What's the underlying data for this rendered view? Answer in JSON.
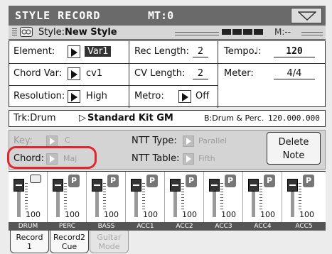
{
  "title_bar": {
    "title": "STYLE RECORD",
    "mt": "MT:0"
  },
  "style_row": {
    "prefix": "Style:",
    "name": "New Style",
    "measure": "M:--"
  },
  "params": {
    "element_label": "Element:",
    "element_value": "Var1",
    "chordvar_label": "Chord Var:",
    "chordvar_value": "cv1",
    "resolution_label": "Resolution:",
    "resolution_value": "High",
    "reclength_label": "Rec Length:",
    "reclength_value": "2",
    "cvlength_label": "CV Length:",
    "cvlength_value": "2",
    "metro_label": "Metro:",
    "metro_value": "Off",
    "tempo_label": "Tempo",
    "tempo_note": "♩:",
    "tempo_value": "120",
    "meter_label": "Meter:",
    "meter_value": "4/4"
  },
  "track_row": {
    "trk": "Trk:Drum",
    "kit": "Standard Kit GM",
    "bank": "B:Drum & Perc.",
    "number": "120.000.000"
  },
  "panel": {
    "key_label": "Key:",
    "key_value": "C",
    "chord_label": "Chord:",
    "chord_value": "Maj",
    "ntt_type_label": "NTT Type:",
    "ntt_type_value": "Parallel",
    "ntt_table_label": "NTT Table:",
    "ntt_table_value": "Fifth",
    "delete_line1": "Delete",
    "delete_line2": "Note"
  },
  "mixer": {
    "channels": [
      {
        "name": "DRUM",
        "volume": "100",
        "badge": ""
      },
      {
        "name": "PERC",
        "volume": "100",
        "badge": "P"
      },
      {
        "name": "BASS",
        "volume": "100",
        "badge": "P"
      },
      {
        "name": "ACC1",
        "volume": "100",
        "badge": "P"
      },
      {
        "name": "ACC2",
        "volume": "100",
        "badge": "P"
      },
      {
        "name": "ACC3",
        "volume": "100",
        "badge": "P"
      },
      {
        "name": "ACC4",
        "volume": "100",
        "badge": "P"
      },
      {
        "name": "ACC5",
        "volume": "100",
        "badge": "P"
      }
    ]
  },
  "tabs": [
    {
      "line1": "Record",
      "line2": "1"
    },
    {
      "line1": "Record2",
      "line2": "Cue"
    },
    {
      "line1": "Guitar",
      "line2": "Mode"
    }
  ],
  "colors": {
    "title_bar": "#6a6a6a",
    "highlight": "#e0272f",
    "selected": "#333333",
    "disabled_text": "#9c9c9c"
  }
}
